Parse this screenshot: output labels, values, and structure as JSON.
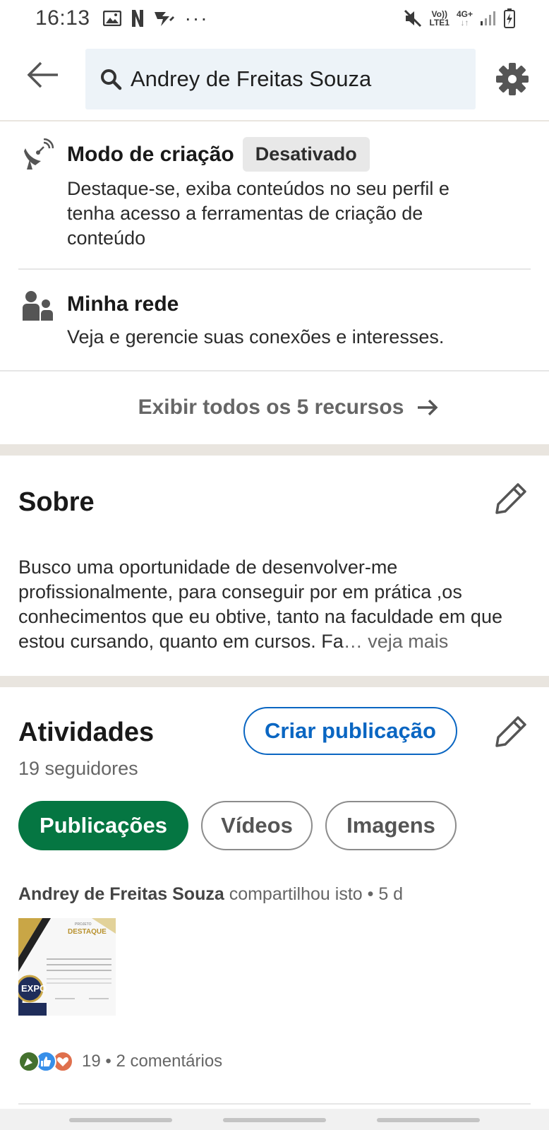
{
  "status_bar": {
    "time": "16:13",
    "left_icons": [
      "image-icon",
      "netflix-icon",
      "app-icon",
      "more-dots-icon"
    ],
    "more_dots": "···",
    "network_top": "Vo))",
    "network_bottom": "LTE1",
    "signal_label": "4G+",
    "right_icons": [
      "mute-icon",
      "volte-icon",
      "signal-icon",
      "battery-icon"
    ]
  },
  "search": {
    "query": "Andrey de Freitas Souza",
    "icons": [
      "back-arrow-icon",
      "search-icon",
      "gear-icon"
    ]
  },
  "resources": [
    {
      "title": "Modo de criação",
      "badge": "Desativado",
      "description": "Destaque-se, exiba conteúdos no seu perfil e tenha acesso a ferramentas de criação de conteúdo",
      "icon": "broadcast-icon"
    },
    {
      "title": "Minha rede",
      "description": "Veja e gerencie suas conexões e interesses.",
      "icon": "people-icon"
    }
  ],
  "show_all": {
    "label": "Exibir todos os 5 recursos"
  },
  "about": {
    "title": "Sobre",
    "text": "Busco uma oportunidade de desenvolver-me profissionalmente, para conseguir por em prática ,os conhecimentos que eu obtive, tanto na faculdade em que estou cursando, quanto em cursos. Fa",
    "ellipsis": "…",
    "see_more": " veja mais"
  },
  "activities": {
    "title": "Atividades",
    "followers": "19 seguidores",
    "create_post": "Criar publicação",
    "tabs": [
      {
        "label": "Publicações",
        "active": true
      },
      {
        "label": "Vídeos",
        "active": false
      },
      {
        "label": "Imagens",
        "active": false
      }
    ],
    "post": {
      "author": "Andrey de Freitas Souza",
      "action": " compartilhou isto • 5 d",
      "thumbnail": {
        "heading_small": "PROJETO",
        "heading": "DESTAQUE",
        "logo_text": "EXPO"
      },
      "reaction_count": "19",
      "comments": " • 2 comentários",
      "reaction_icons": [
        "celebrate-icon",
        "like-icon",
        "love-icon"
      ]
    }
  },
  "colors": {
    "brand_blue": "#0a66c2",
    "active_green": "#057642",
    "band": "#e9e5df",
    "search_bg": "#edf3f8",
    "muted_text": "#666666"
  }
}
